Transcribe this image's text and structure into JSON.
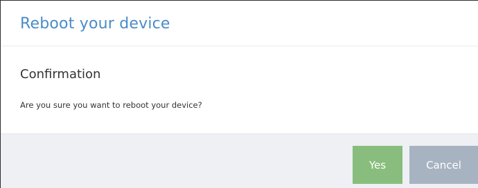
{
  "dialog": {
    "title": "Reboot your device",
    "heading": "Confirmation",
    "message": "Are you sure you want to reboot your device?",
    "buttons": {
      "yes_label": "Yes",
      "cancel_label": "Cancel"
    }
  },
  "colors": {
    "title": "#4a8bc8",
    "yes_button": "#89bd7d",
    "cancel_button": "#a7b3c1",
    "footer_background": "#eef0f4"
  }
}
